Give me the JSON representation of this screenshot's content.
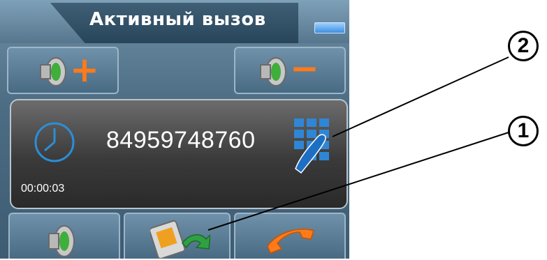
{
  "window": {
    "title": "Активный вызов"
  },
  "call": {
    "number": "84959748760",
    "duration": "00:00:03"
  },
  "buttons": {
    "volume_up": {
      "icon": "speaker-plus-icon"
    },
    "volume_down": {
      "icon": "speaker-minus-icon"
    },
    "speaker": {
      "icon": "speaker-icon"
    },
    "transfer": {
      "icon": "pda-transfer-icon"
    },
    "hangup": {
      "icon": "phone-handset-icon"
    },
    "keypad": {
      "icon": "keypad-icon"
    },
    "minimize": {
      "icon": "minimize-icon"
    }
  },
  "callouts": {
    "one": "1",
    "two": "2"
  },
  "colors": {
    "accent_orange": "#ff7a1a",
    "clock_blue": "#2a8fd8",
    "panel_dark": "#2a2a2a"
  },
  "symbols": {
    "plus": "+",
    "minus": "−"
  }
}
